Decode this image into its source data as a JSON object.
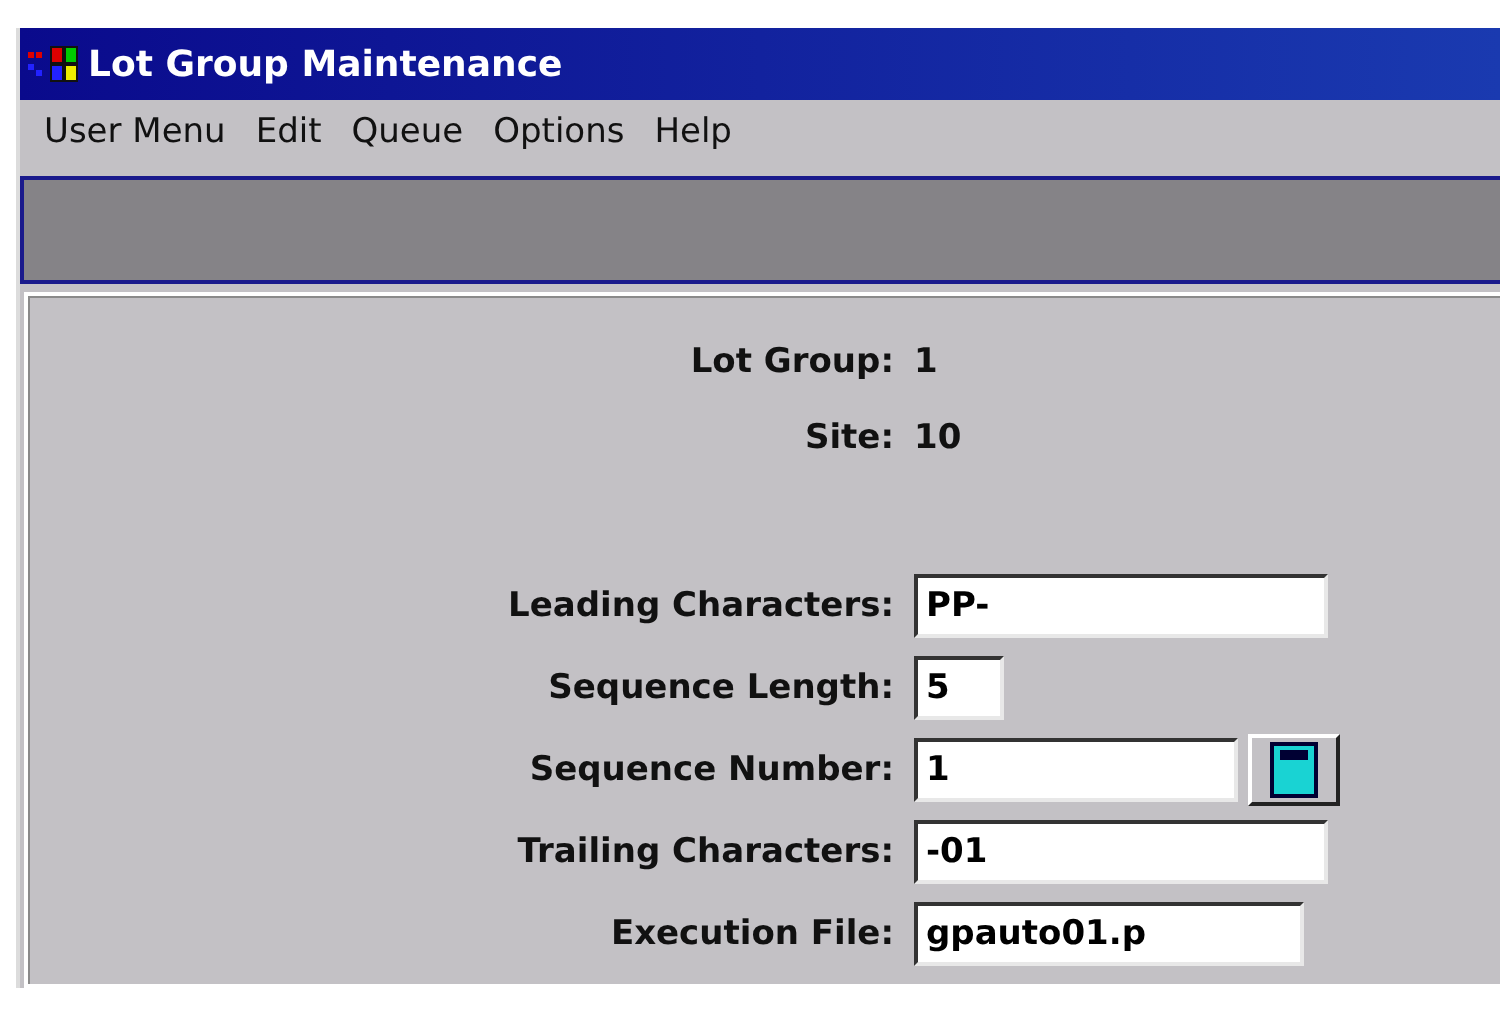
{
  "window": {
    "title": "Lot Group Maintenance"
  },
  "menu": [
    "User Menu",
    "Edit",
    "Queue",
    "Options",
    "Help"
  ],
  "info": [
    {
      "label": "Lot Group:",
      "value": "1"
    },
    {
      "label": "Site:",
      "value": "10"
    }
  ],
  "fields": [
    {
      "label": "Leading Characters:",
      "value": "PP-",
      "calculator": false
    },
    {
      "label": "Sequence Length:",
      "value": "5",
      "calculator": false
    },
    {
      "label": "Sequence Number:",
      "value": "1",
      "calculator": true
    },
    {
      "label": "Trailing Characters:",
      "value": "-01",
      "calculator": false
    },
    {
      "label": "Execution File:",
      "value": "gpauto01.p",
      "calculator": false
    }
  ]
}
